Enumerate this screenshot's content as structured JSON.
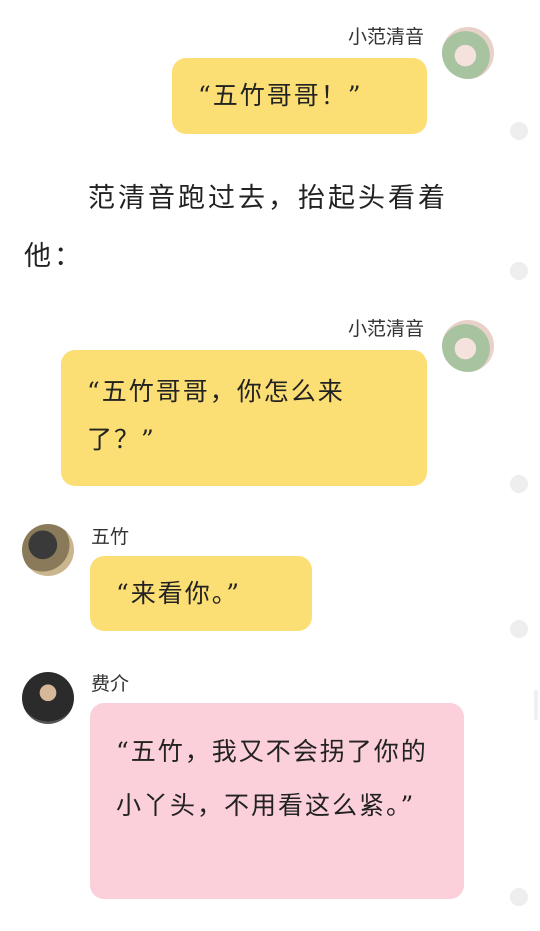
{
  "messages": [
    {
      "speaker": "小范清音",
      "text": "“五竹哥哥！”"
    },
    {
      "speaker": "小范清音",
      "text": "“五竹哥哥，你怎么来了？”"
    },
    {
      "speaker": "五竹",
      "text": "“来看你。”"
    },
    {
      "speaker": "费介",
      "text": "“五竹，我又不会拐了你的小丫头，不用看这么紧。”"
    }
  ],
  "narration": "范清音跑过去，抬起头看着他：",
  "avatars": [
    "girl-avatar",
    "girl-avatar",
    "man-avatar",
    "elder-avatar"
  ],
  "colors": {
    "bubble_yellow": "#fbdf74",
    "bubble_pink": "#fbd0da",
    "background": "#ffffff"
  }
}
